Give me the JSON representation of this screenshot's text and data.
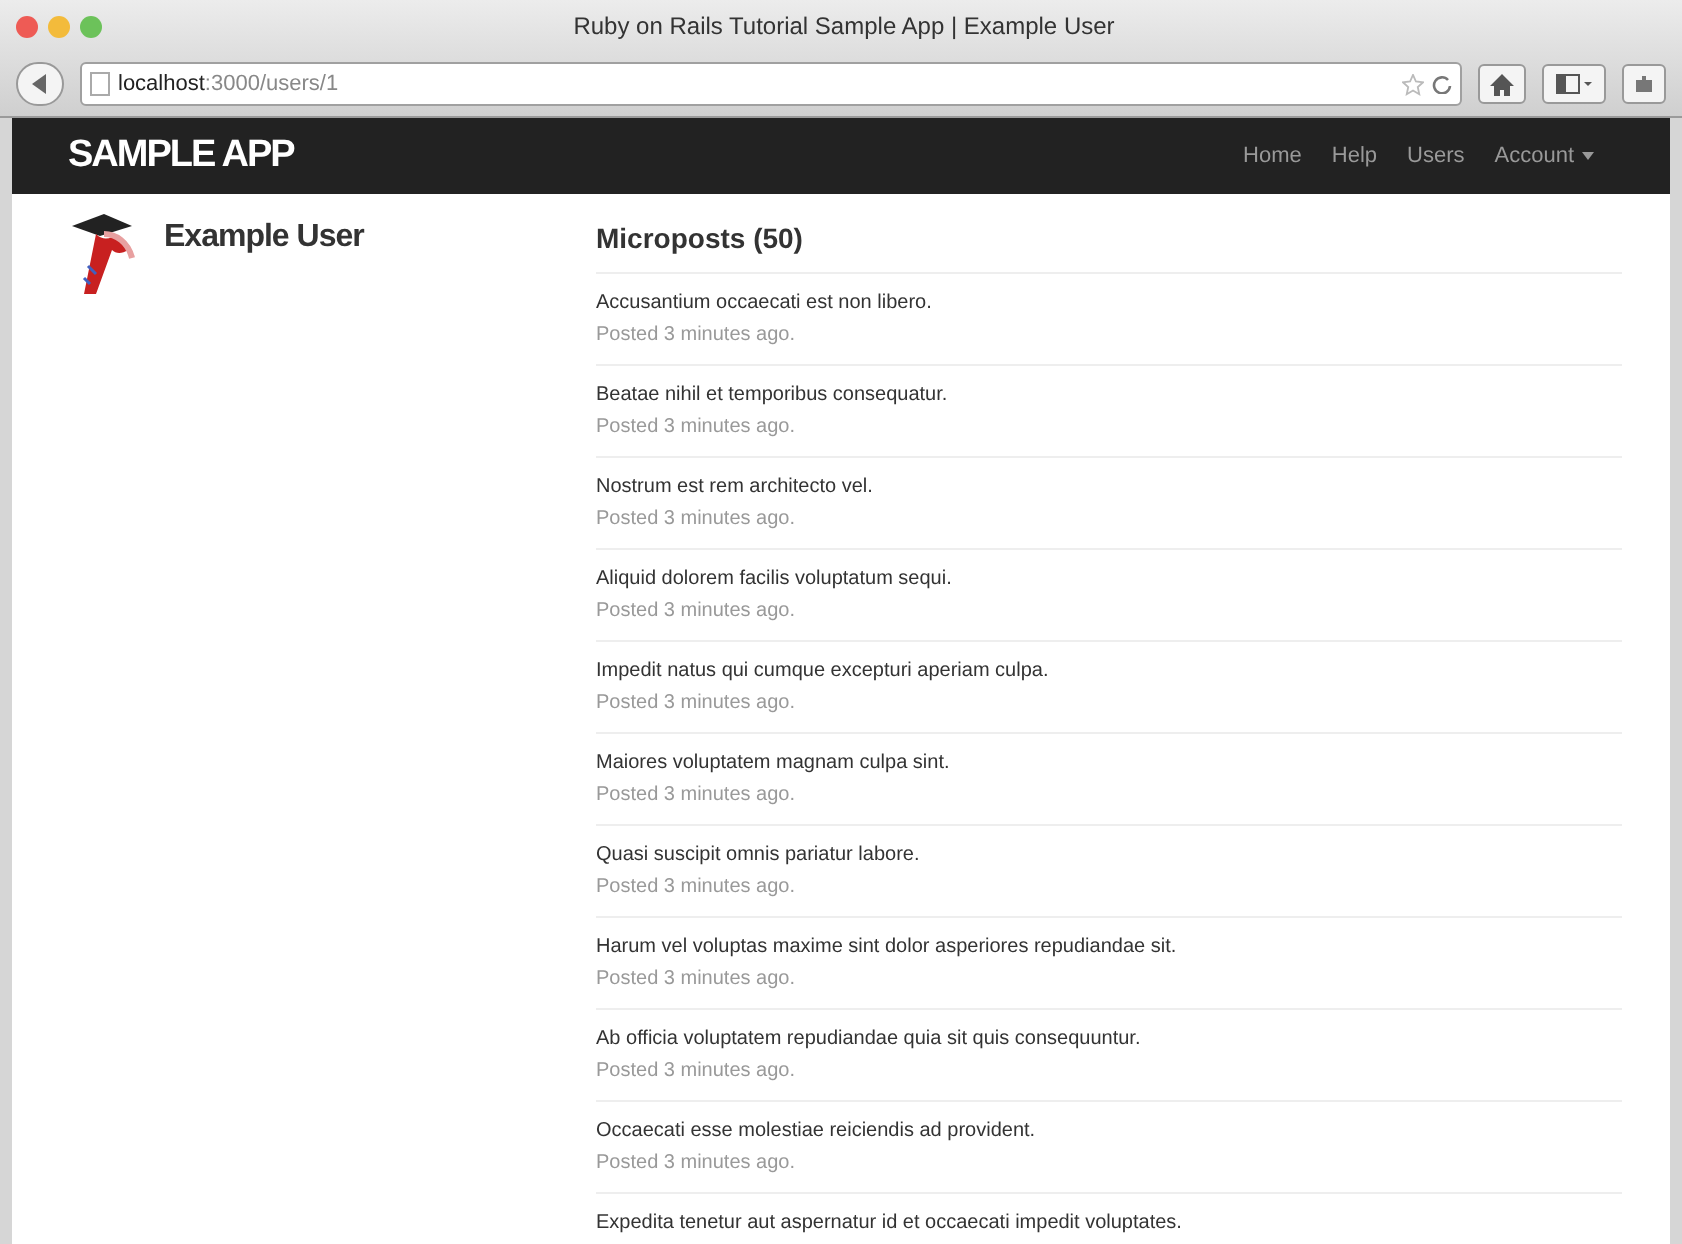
{
  "window": {
    "title": "Ruby on Rails Tutorial Sample App | Example User"
  },
  "address_bar": {
    "host": "localhost",
    "path": ":3000/users/1"
  },
  "navbar": {
    "brand": "SAMPLE APP",
    "links": [
      {
        "label": "Home",
        "kind": "link"
      },
      {
        "label": "Help",
        "kind": "link"
      },
      {
        "label": "Users",
        "kind": "link"
      },
      {
        "label": "Account",
        "kind": "dropdown"
      }
    ]
  },
  "user": {
    "name": "Example User"
  },
  "microposts": {
    "heading": "Microposts (50)",
    "items": [
      {
        "content": "Accusantium occaecati est non libero.",
        "timestamp": "Posted 3 minutes ago."
      },
      {
        "content": "Beatae nihil et temporibus consequatur.",
        "timestamp": "Posted 3 minutes ago."
      },
      {
        "content": "Nostrum est rem architecto vel.",
        "timestamp": "Posted 3 minutes ago."
      },
      {
        "content": "Aliquid dolorem facilis voluptatum sequi.",
        "timestamp": "Posted 3 minutes ago."
      },
      {
        "content": "Impedit natus qui cumque excepturi aperiam culpa.",
        "timestamp": "Posted 3 minutes ago."
      },
      {
        "content": "Maiores voluptatem magnam culpa sint.",
        "timestamp": "Posted 3 minutes ago."
      },
      {
        "content": "Quasi suscipit omnis pariatur labore.",
        "timestamp": "Posted 3 minutes ago."
      },
      {
        "content": "Harum vel voluptas maxime sint dolor asperiores repudiandae sit.",
        "timestamp": "Posted 3 minutes ago."
      },
      {
        "content": "Ab officia voluptatem repudiandae quia sit quis consequuntur.",
        "timestamp": "Posted 3 minutes ago."
      },
      {
        "content": "Occaecati esse molestiae reiciendis ad provident.",
        "timestamp": "Posted 3 minutes ago."
      },
      {
        "content": "Expedita tenetur aut aspernatur id et occaecati impedit voluptates."
      }
    ]
  }
}
